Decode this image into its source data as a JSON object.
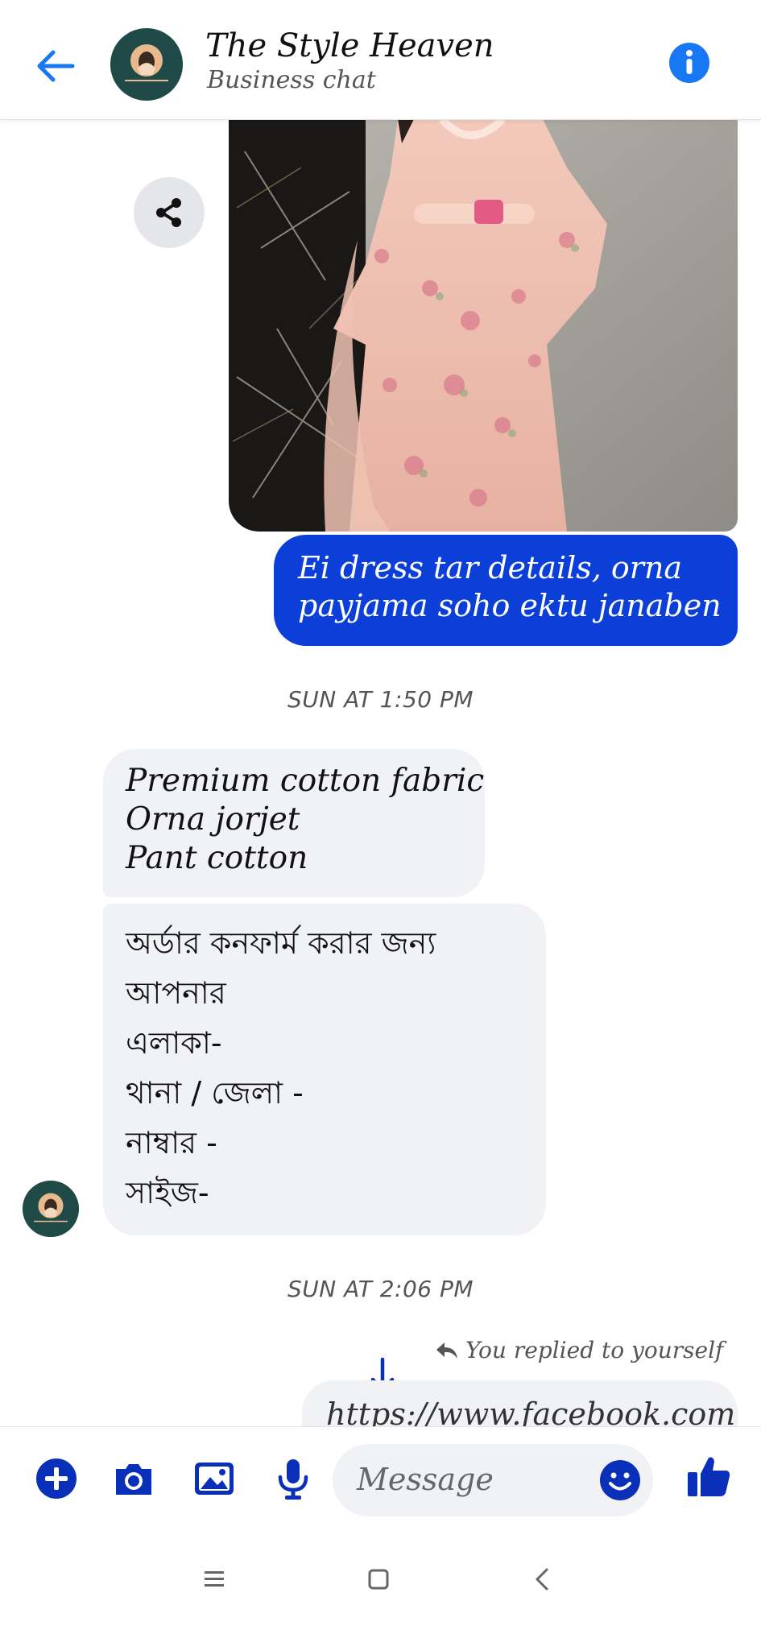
{
  "header": {
    "title": "The Style Heaven",
    "subtitle": "Business chat"
  },
  "messages": {
    "outgoing_text": [
      "Ei dress tar details, orna",
      "payjama soho ektu janaben"
    ],
    "timestamp_1": "SUN AT 1:50 PM",
    "incoming_1": [
      "Premium cotton fabric",
      "Orna jorjet",
      "Pant cotton"
    ],
    "incoming_2": [
      "অর্ডার কনফার্ম করার জন্য",
      "আপনার",
      "এলাকা-",
      "থানা / জেলা -",
      "নাম্বার -",
      "সাইজ-"
    ],
    "timestamp_2": "SUN AT 2:06 PM",
    "replied_note": "You replied to yourself",
    "link_text": "https://www.facebook.com"
  },
  "composer": {
    "placeholder": "Message"
  },
  "colors": {
    "accent_blue": "#0c3ed8",
    "icon_blue": "#0a2fb8",
    "header_blue": "#1877f2",
    "bubble_grey": "#f0f2f5"
  },
  "icons": {
    "back": "arrow-left-icon",
    "info": "info-icon",
    "share": "share-icon",
    "plus": "plus-icon",
    "camera": "camera-icon",
    "gallery": "image-icon",
    "mic": "microphone-icon",
    "emoji": "emoji-icon",
    "like": "thumbs-up-icon",
    "reply": "reply-arrow-icon",
    "scroll_down": "arrow-down-icon"
  }
}
